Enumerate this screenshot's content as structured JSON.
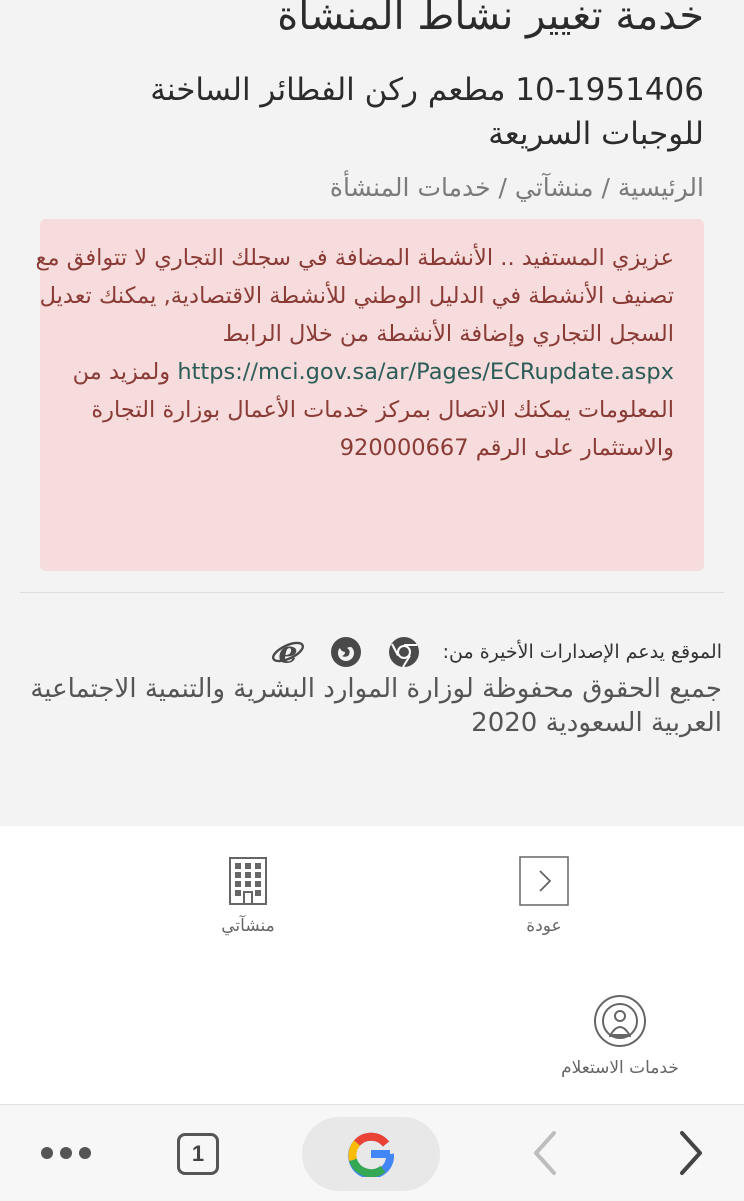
{
  "header": {
    "title": "خدمة تغيير نشاط المنشأة",
    "subtitle": "10-1951406 مطعم ركن الفطائر الساخنة للوجبات السريعة"
  },
  "breadcrumb": {
    "home": "الرئيسية",
    "sep1": " / ",
    "establishments": "منشآتي",
    "sep2": " / ",
    "current": "خدمات المنشأة"
  },
  "alert": {
    "text_part1": "عزيزي المستفيد .. الأنشطة المضافة في سجلك التجاري لا تتوافق مع تصنيف الأنشطة في الدليل الوطني للأنشطة الاقتصادية, يمكنك تعديل السجل التجاري وإضافة الأنشطة من خلال الرابط ",
    "link": "https://mci.gov.sa/ar/Pages/ECRupdate.aspx",
    "text_part2": " ولمزيد من المعلومات يمكنك الاتصال بمركز خدمات الأعمال بوزارة التجارة والاستثمار على الرقم ",
    "phone": "920000667",
    "color": "#f6dcdc"
  },
  "footer": {
    "support_label": "الموقع يدعم الإصدارات الأخيرة من:",
    "browsers": [
      "chrome-icon",
      "firefox-icon",
      "ie-icon"
    ],
    "copyright": "جميع الحقوق محفوظة لوزارة الموارد البشرية والتنمية الاجتماعية العربية السعودية 2020"
  },
  "bottom_nav": {
    "back_label": "عودة",
    "my_establishments_label": "منشآتي",
    "inquiry_label": "خدمات الاستعلام"
  },
  "browser_bar": {
    "tab_count": "1",
    "icons": [
      "more-icon",
      "tabs-icon",
      "google-icon",
      "back-icon",
      "forward-icon"
    ]
  }
}
